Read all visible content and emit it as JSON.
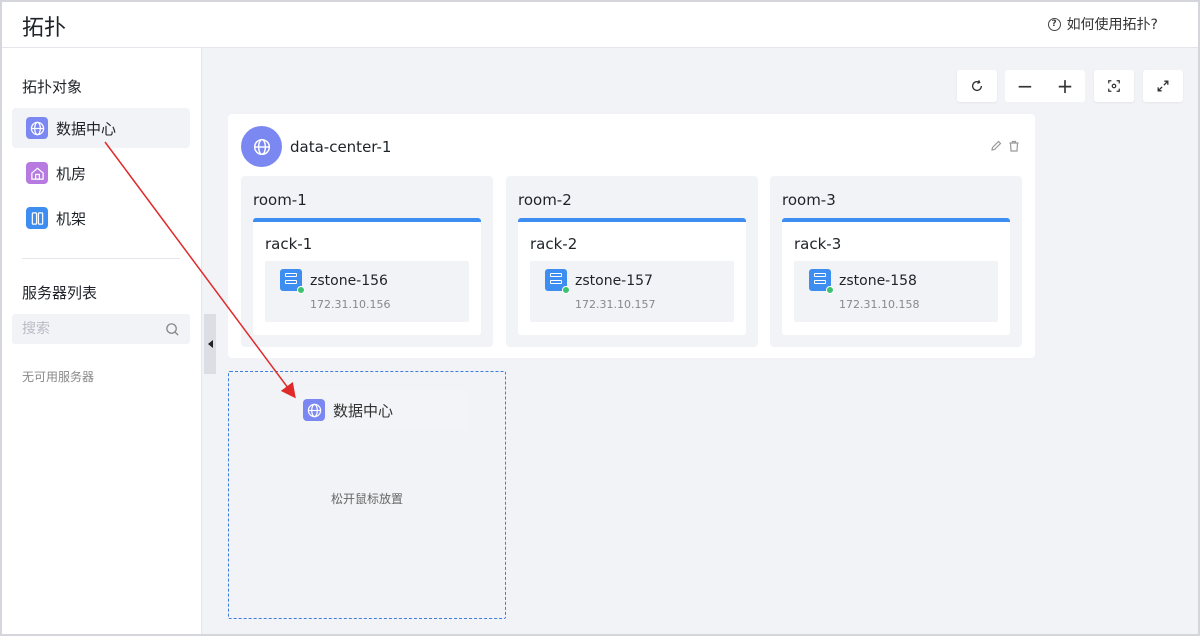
{
  "header": {
    "title": "拓扑",
    "help_label": "如何使用拓扑?"
  },
  "sidebar": {
    "objects_title": "拓扑对象",
    "objects": [
      {
        "label": "数据中心",
        "icon": "globe-icon",
        "color": "#7c88f2"
      },
      {
        "label": "机房",
        "icon": "house-icon",
        "color": "#b77ae0"
      },
      {
        "label": "机架",
        "icon": "rack-icon",
        "color": "#3d8ef0"
      }
    ],
    "servers_title": "服务器列表",
    "search_placeholder": "搜索",
    "empty_text": "无可用服务器"
  },
  "datacenter": {
    "name": "data-center-1",
    "rooms": [
      {
        "name": "room-1",
        "rack": "rack-1",
        "server": "zstone-156",
        "ip": "172.31.10.156"
      },
      {
        "name": "room-2",
        "rack": "rack-2",
        "server": "zstone-157",
        "ip": "172.31.10.157"
      },
      {
        "name": "room-3",
        "rack": "rack-3",
        "server": "zstone-158",
        "ip": "172.31.10.158"
      }
    ]
  },
  "drop_zone": {
    "ghost_label": "数据中心",
    "hint": "松开鼠标放置"
  },
  "colors": {
    "accent": "#3d8ef0",
    "status_online": "#3dc26e",
    "arrow": "#e02a2a"
  }
}
